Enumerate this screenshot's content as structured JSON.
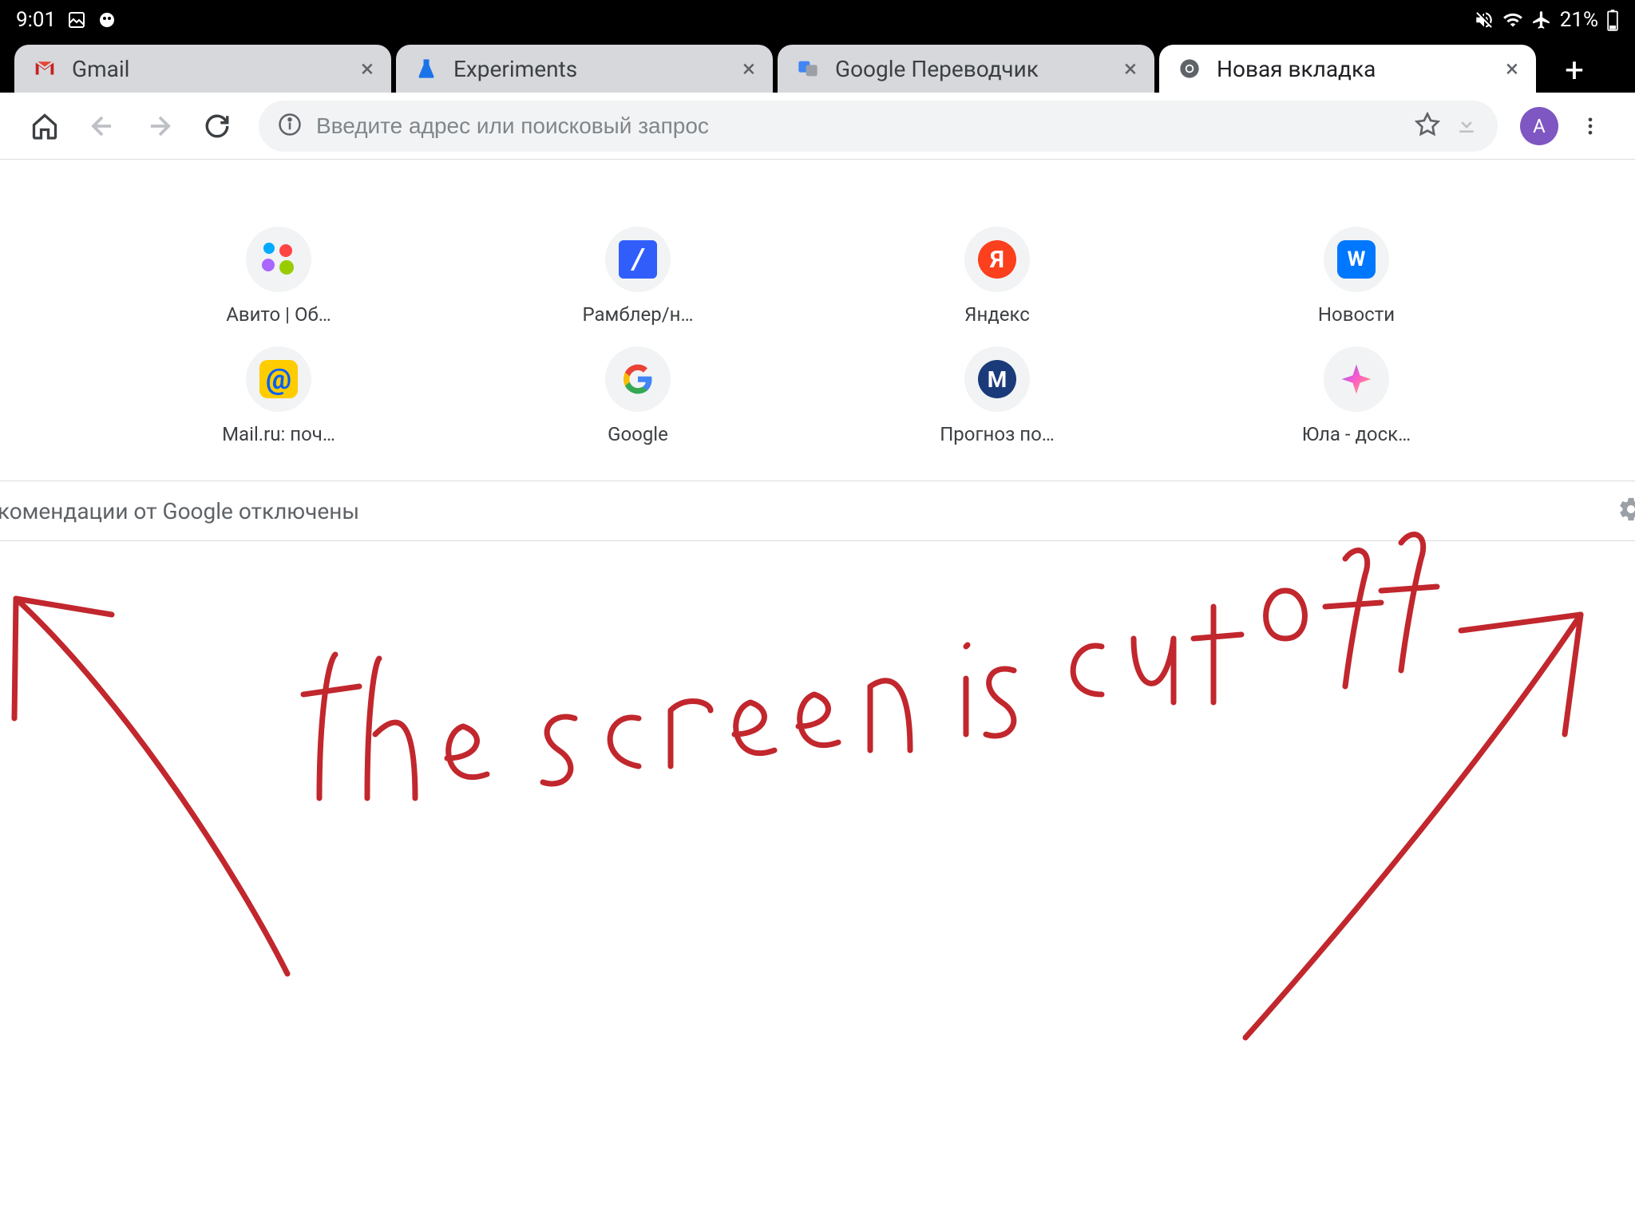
{
  "status": {
    "time": "9:01",
    "battery": "21%"
  },
  "tabs": [
    {
      "title": "Gmail",
      "faviconType": "gmail",
      "active": false
    },
    {
      "title": "Experiments",
      "faviconType": "flask",
      "active": false
    },
    {
      "title": "Google Переводчик",
      "faviconType": "translate",
      "active": false
    },
    {
      "title": "Новая вкладка",
      "faviconType": "chrome",
      "active": true
    }
  ],
  "toolbar": {
    "omniboxPlaceholder": "Введите адрес или поисковый запрос",
    "avatarLetter": "A"
  },
  "shortcuts": [
    {
      "label": "Авито | Об…",
      "iconKey": "avito"
    },
    {
      "label": "Рамблер/н…",
      "iconKey": "rambler"
    },
    {
      "label": "Яндекс",
      "iconKey": "yandex"
    },
    {
      "label": "Новости",
      "iconKey": "vk"
    },
    {
      "label": "Mail.ru: поч…",
      "iconKey": "mail"
    },
    {
      "label": "Google",
      "iconKey": "google"
    },
    {
      "label": "Прогноз по…",
      "iconKey": "prognoz"
    },
    {
      "label": "Юла - доск…",
      "iconKey": "youla"
    }
  ],
  "recommendations": {
    "text": "екомендации от Google отключены"
  },
  "annotation": {
    "text": "the screen is cut off"
  }
}
